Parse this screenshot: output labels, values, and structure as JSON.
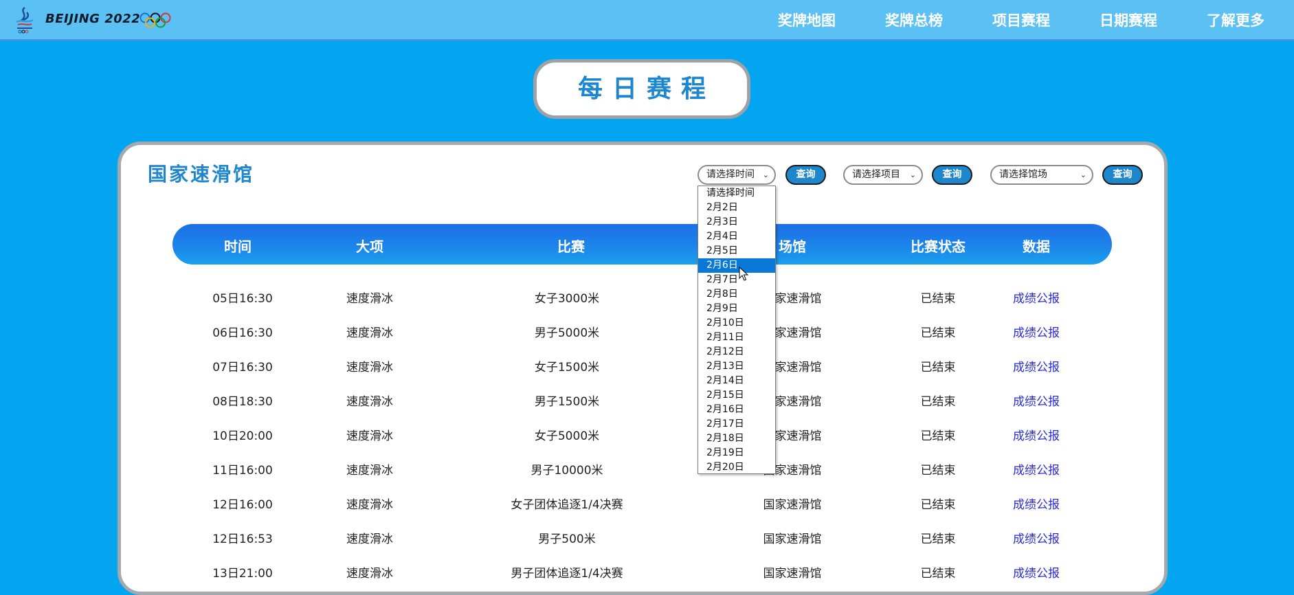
{
  "header": {
    "brand": "BEIJING 2022",
    "emblem_icon": "beijing-2022-emblem-icon",
    "rings_icon": "olympic-rings-icon",
    "nav": [
      "奖牌地图",
      "奖牌总榜",
      "项目赛程",
      "日期赛程",
      "了解更多"
    ]
  },
  "page_title": "每日赛程",
  "venue_title": "国家速滑馆",
  "filters": {
    "time_select": "请选择时间",
    "event_select": "请选择项目",
    "venue_select": "请选择馆场",
    "query_label": "查询"
  },
  "dropdown": {
    "selected": "2月6日",
    "options": [
      "请选择时间",
      "2月2日",
      "2月3日",
      "2月4日",
      "2月5日",
      "2月6日",
      "2月7日",
      "2月8日",
      "2月9日",
      "2月10日",
      "2月11日",
      "2月12日",
      "2月13日",
      "2月14日",
      "2月15日",
      "2月16日",
      "2月17日",
      "2月18日",
      "2月19日",
      "2月20日"
    ]
  },
  "table": {
    "columns": [
      "时间",
      "大项",
      "比赛",
      "场馆",
      "比赛状态",
      "数据"
    ],
    "rows": [
      {
        "time": "05日16:30",
        "sport": "速度滑冰",
        "event": "女子3000米",
        "venue": "国家速滑馆",
        "status": "已结束",
        "data": "成绩公报"
      },
      {
        "time": "06日16:30",
        "sport": "速度滑冰",
        "event": "男子5000米",
        "venue": "国家速滑馆",
        "status": "已结束",
        "data": "成绩公报"
      },
      {
        "time": "07日16:30",
        "sport": "速度滑冰",
        "event": "女子1500米",
        "venue": "国家速滑馆",
        "status": "已结束",
        "data": "成绩公报"
      },
      {
        "time": "08日18:30",
        "sport": "速度滑冰",
        "event": "男子1500米",
        "venue": "国家速滑馆",
        "status": "已结束",
        "data": "成绩公报"
      },
      {
        "time": "10日20:00",
        "sport": "速度滑冰",
        "event": "女子5000米",
        "venue": "国家速滑馆",
        "status": "已结束",
        "data": "成绩公报"
      },
      {
        "time": "11日16:00",
        "sport": "速度滑冰",
        "event": "男子10000米",
        "venue": "国家速滑馆",
        "status": "已结束",
        "data": "成绩公报"
      },
      {
        "time": "12日16:00",
        "sport": "速度滑冰",
        "event": "女子团体追逐1/4决赛",
        "venue": "国家速滑馆",
        "status": "已结束",
        "data": "成绩公报"
      },
      {
        "time": "12日16:53",
        "sport": "速度滑冰",
        "event": "男子500米",
        "venue": "国家速滑馆",
        "status": "已结束",
        "data": "成绩公报"
      },
      {
        "time": "13日21:00",
        "sport": "速度滑冰",
        "event": "男子团体追逐1/4决赛",
        "venue": "国家速滑馆",
        "status": "已结束",
        "data": "成绩公报"
      }
    ]
  }
}
